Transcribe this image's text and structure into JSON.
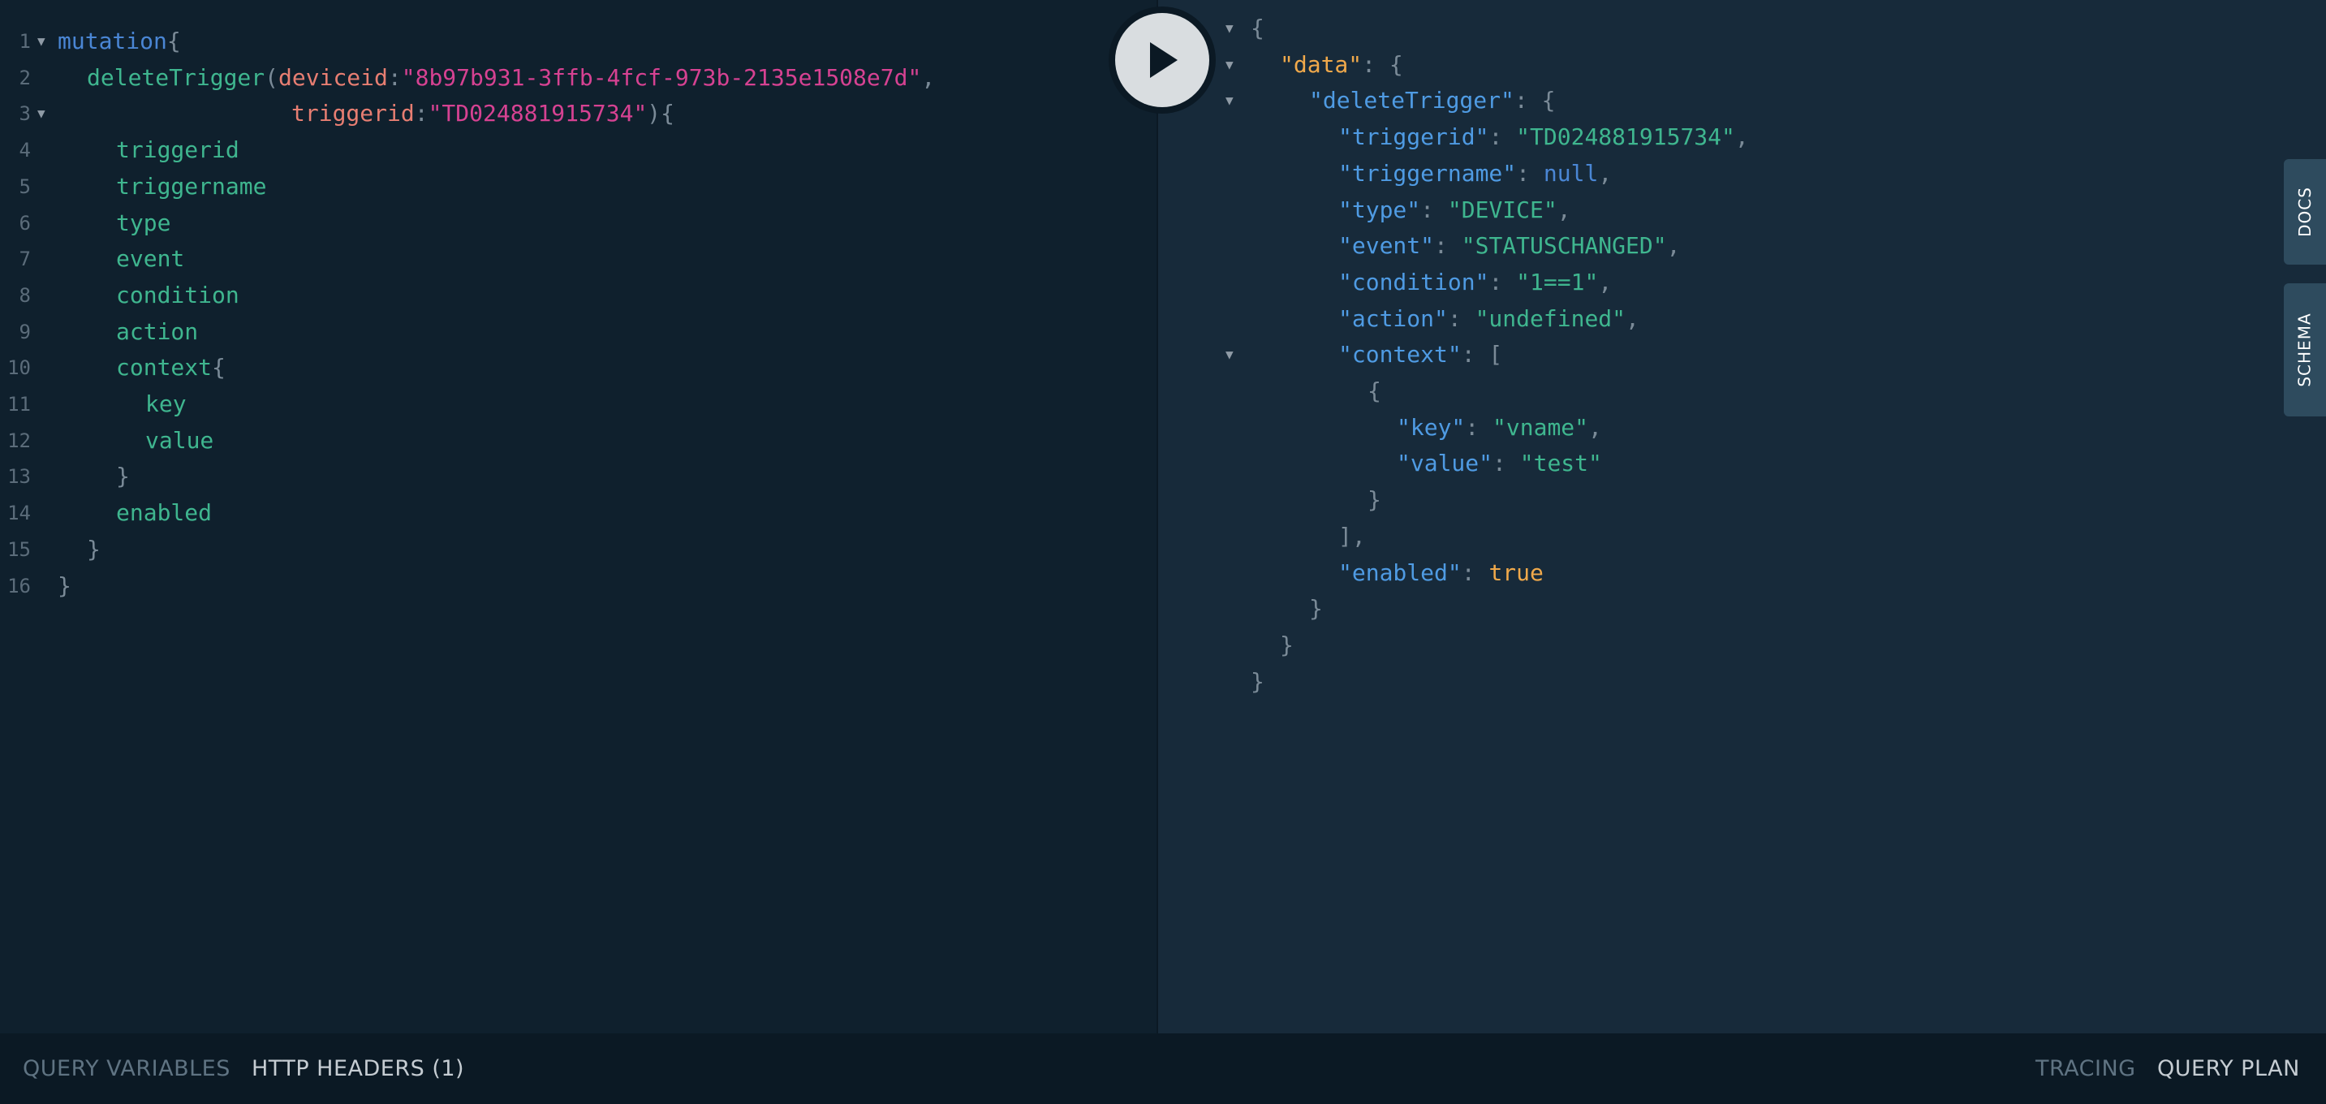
{
  "run_button": {
    "icon": "play-icon"
  },
  "query_lines": [
    {
      "num": "1",
      "fold": true,
      "tokens": [
        {
          "t": "mutation",
          "c": "kw"
        },
        {
          "t": "{",
          "c": "pun"
        }
      ],
      "indent": 0
    },
    {
      "num": "2",
      "fold": false,
      "tokens": [
        {
          "t": "deleteTrigger",
          "c": "fld"
        },
        {
          "t": "(",
          "c": "pun"
        },
        {
          "t": "deviceid",
          "c": "arg"
        },
        {
          "t": ":",
          "c": "pun"
        },
        {
          "t": "\"8b97b931-3ffb-4fcf-973b-2135e1508e7d\"",
          "c": "str"
        },
        {
          "t": ",",
          "c": "pun"
        }
      ],
      "indent": 1
    },
    {
      "num": "3",
      "fold": true,
      "tokens": [
        {
          "t": "triggerid",
          "c": "arg"
        },
        {
          "t": ":",
          "c": "pun"
        },
        {
          "t": "\"TD024881915734\"",
          "c": "str"
        },
        {
          "t": "){",
          "c": "pun"
        }
      ],
      "indent": 8
    },
    {
      "num": "4",
      "fold": false,
      "tokens": [
        {
          "t": "triggerid",
          "c": "fld"
        }
      ],
      "indent": 2
    },
    {
      "num": "5",
      "fold": false,
      "tokens": [
        {
          "t": "triggername",
          "c": "fld"
        }
      ],
      "indent": 2
    },
    {
      "num": "6",
      "fold": false,
      "tokens": [
        {
          "t": "type",
          "c": "fld"
        }
      ],
      "indent": 2
    },
    {
      "num": "7",
      "fold": false,
      "tokens": [
        {
          "t": "event",
          "c": "fld"
        }
      ],
      "indent": 2
    },
    {
      "num": "8",
      "fold": false,
      "tokens": [
        {
          "t": "condition",
          "c": "fld"
        }
      ],
      "indent": 2
    },
    {
      "num": "9",
      "fold": false,
      "tokens": [
        {
          "t": "action",
          "c": "fld"
        }
      ],
      "indent": 2
    },
    {
      "num": "10",
      "fold": false,
      "tokens": [
        {
          "t": "context",
          "c": "fld"
        },
        {
          "t": "{",
          "c": "pun"
        }
      ],
      "indent": 2
    },
    {
      "num": "11",
      "fold": false,
      "tokens": [
        {
          "t": "key",
          "c": "fld"
        }
      ],
      "indent": 3
    },
    {
      "num": "12",
      "fold": false,
      "tokens": [
        {
          "t": "value",
          "c": "fld"
        }
      ],
      "indent": 3
    },
    {
      "num": "13",
      "fold": false,
      "tokens": [
        {
          "t": "}",
          "c": "pun"
        }
      ],
      "indent": 2
    },
    {
      "num": "14",
      "fold": false,
      "tokens": [
        {
          "t": "enabled",
          "c": "fld"
        }
      ],
      "indent": 2
    },
    {
      "num": "15",
      "fold": false,
      "tokens": [
        {
          "t": "}",
          "c": "pun"
        }
      ],
      "indent": 1
    },
    {
      "num": "16",
      "fold": false,
      "tokens": [
        {
          "t": "}",
          "c": "pun"
        }
      ],
      "indent": 0
    }
  ],
  "result_lines": [
    {
      "fold": true,
      "indent": 0,
      "tokens": [
        {
          "t": "{",
          "c": "jpun"
        }
      ]
    },
    {
      "fold": true,
      "indent": 1,
      "tokens": [
        {
          "t": "\"data\"",
          "c": "jdata"
        },
        {
          "t": ": {",
          "c": "jpun"
        }
      ]
    },
    {
      "fold": true,
      "indent": 2,
      "tokens": [
        {
          "t": "\"deleteTrigger\"",
          "c": "jkey"
        },
        {
          "t": ": {",
          "c": "jpun"
        }
      ]
    },
    {
      "fold": false,
      "indent": 3,
      "tokens": [
        {
          "t": "\"triggerid\"",
          "c": "jkey"
        },
        {
          "t": ": ",
          "c": "jpun"
        },
        {
          "t": "\"TD024881915734\"",
          "c": "jstr"
        },
        {
          "t": ",",
          "c": "jpun"
        }
      ]
    },
    {
      "fold": false,
      "indent": 3,
      "tokens": [
        {
          "t": "\"triggername\"",
          "c": "jkey"
        },
        {
          "t": ": ",
          "c": "jpun"
        },
        {
          "t": "null",
          "c": "jnull"
        },
        {
          "t": ",",
          "c": "jpun"
        }
      ]
    },
    {
      "fold": false,
      "indent": 3,
      "tokens": [
        {
          "t": "\"type\"",
          "c": "jkey"
        },
        {
          "t": ": ",
          "c": "jpun"
        },
        {
          "t": "\"DEVICE\"",
          "c": "jstr"
        },
        {
          "t": ",",
          "c": "jpun"
        }
      ]
    },
    {
      "fold": false,
      "indent": 3,
      "tokens": [
        {
          "t": "\"event\"",
          "c": "jkey"
        },
        {
          "t": ": ",
          "c": "jpun"
        },
        {
          "t": "\"STATUSCHANGED\"",
          "c": "jstr"
        },
        {
          "t": ",",
          "c": "jpun"
        }
      ]
    },
    {
      "fold": false,
      "indent": 3,
      "tokens": [
        {
          "t": "\"condition\"",
          "c": "jkey"
        },
        {
          "t": ": ",
          "c": "jpun"
        },
        {
          "t": "\"1==1\"",
          "c": "jstr"
        },
        {
          "t": ",",
          "c": "jpun"
        }
      ]
    },
    {
      "fold": false,
      "indent": 3,
      "tokens": [
        {
          "t": "\"action\"",
          "c": "jkey"
        },
        {
          "t": ": ",
          "c": "jpun"
        },
        {
          "t": "\"undefined\"",
          "c": "jstr"
        },
        {
          "t": ",",
          "c": "jpun"
        }
      ]
    },
    {
      "fold": true,
      "indent": 3,
      "tokens": [
        {
          "t": "\"context\"",
          "c": "jkey"
        },
        {
          "t": ": [",
          "c": "jpun"
        }
      ]
    },
    {
      "fold": false,
      "indent": 4,
      "tokens": [
        {
          "t": "{",
          "c": "jpun"
        }
      ]
    },
    {
      "fold": false,
      "indent": 5,
      "tokens": [
        {
          "t": "\"key\"",
          "c": "jkey"
        },
        {
          "t": ": ",
          "c": "jpun"
        },
        {
          "t": "\"vname\"",
          "c": "jstr"
        },
        {
          "t": ",",
          "c": "jpun"
        }
      ]
    },
    {
      "fold": false,
      "indent": 5,
      "tokens": [
        {
          "t": "\"value\"",
          "c": "jkey"
        },
        {
          "t": ": ",
          "c": "jpun"
        },
        {
          "t": "\"test\"",
          "c": "jstr"
        }
      ]
    },
    {
      "fold": false,
      "indent": 4,
      "tokens": [
        {
          "t": "}",
          "c": "jpun"
        }
      ]
    },
    {
      "fold": false,
      "indent": 3,
      "tokens": [
        {
          "t": "],",
          "c": "jpun"
        }
      ]
    },
    {
      "fold": false,
      "indent": 3,
      "tokens": [
        {
          "t": "\"enabled\"",
          "c": "jkey"
        },
        {
          "t": ": ",
          "c": "jpun"
        },
        {
          "t": "true",
          "c": "jtrue"
        }
      ]
    },
    {
      "fold": false,
      "indent": 2,
      "tokens": [
        {
          "t": "}",
          "c": "jpun"
        }
      ]
    },
    {
      "fold": false,
      "indent": 1,
      "tokens": [
        {
          "t": "}",
          "c": "jpun"
        }
      ]
    },
    {
      "fold": false,
      "indent": 0,
      "tokens": [
        {
          "t": "}",
          "c": "jpun"
        }
      ]
    }
  ],
  "side_tabs": {
    "docs": "DOCS",
    "schema": "SCHEMA"
  },
  "footer": {
    "query_variables": "QUERY VARIABLES",
    "http_headers": "HTTP HEADERS (1)",
    "tracing": "TRACING",
    "query_plan": "QUERY PLAN"
  },
  "colors": {
    "editor_bg": "#0f202d",
    "result_bg": "#172a3a",
    "footer_bg": "#0b1924",
    "field": "#3fb68f",
    "keyword": "#4a86d4",
    "argument": "#e77e72",
    "string": "#d64292",
    "json_key": "#4f9be3",
    "json_data_key": "#f0a94b"
  }
}
